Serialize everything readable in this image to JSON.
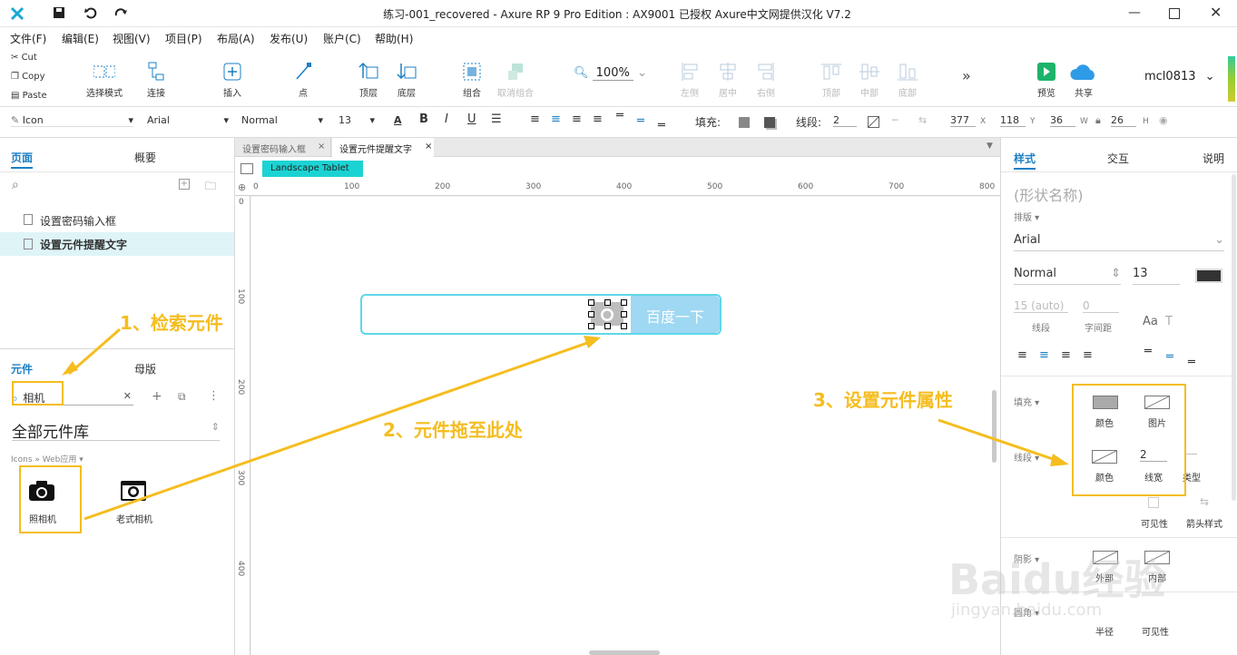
{
  "window": {
    "title": "练习-001_recovered - Axure RP 9 Pro Edition : AX9001 已授权      Axure中文网提供汉化 V7.2"
  },
  "menu": [
    "文件(F)",
    "编辑(E)",
    "视图(V)",
    "项目(P)",
    "布局(A)",
    "发布(U)",
    "账户(C)",
    "帮助(H)"
  ],
  "clipboard": {
    "cut": "Cut",
    "copy": "Copy",
    "paste": "Paste"
  },
  "toolbar": {
    "select_mode": "选择模式",
    "connect": "连接",
    "insert": "插入",
    "point": "点",
    "top_layer": "顶层",
    "bottom_layer": "底层",
    "group": "组合",
    "ungroup": "取消组合",
    "zoom": "100%",
    "align_left": "左侧",
    "align_center": "居中",
    "align_right": "右侧",
    "align_top": "顶部",
    "align_middle": "中部",
    "align_bottom": "底部",
    "more": "»",
    "preview": "预览",
    "share": "共享",
    "user": "mcl0813"
  },
  "stylebar": {
    "widget_style": "Icon",
    "font": "Arial",
    "weight": "Normal",
    "size": "13",
    "fill_label": "填充:",
    "stroke_label": "线段:",
    "stroke_width": "2",
    "x": "377",
    "x_lbl": "X",
    "y": "118",
    "y_lbl": "Y",
    "w": "36",
    "w_lbl": "W",
    "h": "26",
    "h_lbl": "H"
  },
  "left": {
    "tabs": [
      "页面",
      "概要"
    ],
    "pages": [
      "设置密码输入框",
      "设置元件提醒文字"
    ],
    "lib_tabs": [
      "元件",
      "母版"
    ],
    "search_value": "相机",
    "library": "全部元件库",
    "breadcrumb": "Icons » Web应用 ▾",
    "items": [
      "照相机",
      "老式相机"
    ]
  },
  "canvas": {
    "tabs": [
      "设置密码输入框",
      "设置元件提醒文字"
    ],
    "device": "Landscape Tablet",
    "ruler_h": [
      "0",
      "100",
      "200",
      "300",
      "400",
      "500",
      "600",
      "700",
      "800"
    ],
    "ruler_v": [
      "0",
      "100",
      "200",
      "300",
      "400"
    ],
    "button_text": "百度一下"
  },
  "right": {
    "tabs": [
      "样式",
      "交互",
      "说明"
    ],
    "shape_name": "(形状名称)",
    "typography_label": "排版 ▾",
    "font": "Arial",
    "weight": "Normal",
    "size": "13",
    "line_spacing_val": "15 (auto)",
    "line_spacing_lbl": "线段",
    "char_spacing_val": "0",
    "char_spacing_lbl": "字间距",
    "fill_label": "填充 ▾",
    "fill_color": "颜色",
    "fill_image": "图片",
    "stroke_label": "线段 ▾",
    "stroke_color": "颜色",
    "stroke_width_val": "2",
    "stroke_width_lbl": "线宽",
    "stroke_type": "类型",
    "visibility": "可见性",
    "arrow_style": "箭头样式",
    "shadow_label": "阴影 ▾",
    "outer": "外部",
    "inner": "内部",
    "corner_label": "圆角 ▾",
    "radius": "半径",
    "visibility2": "可见性"
  },
  "annotations": {
    "step1": "1、检索元件",
    "step2": "2、元件拖至此处",
    "step3": "3、设置元件属性"
  },
  "watermark": {
    "brand": "Baidu经验",
    "url": "jingyan.baidu.com"
  },
  "colors": {
    "accent": "#1b7fc4",
    "annotation": "#f5bd1f",
    "device_tag": "#1cd3d3",
    "button_bg": "#9fd8f2",
    "input_border": "#5ed7e8",
    "preview_green": "#1db36b",
    "share_blue": "#2e9be6"
  }
}
